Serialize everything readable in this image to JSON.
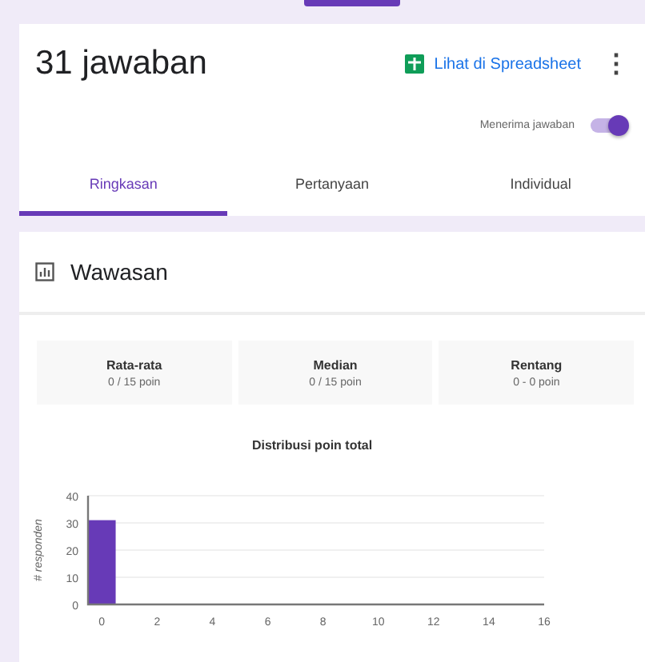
{
  "header": {
    "title": "31 jawaban",
    "spreadsheet_link": "Lihat di Spreadsheet",
    "more": "⋮",
    "accepting": {
      "label": "Menerima jawaban",
      "on": true
    }
  },
  "tabs": [
    {
      "label": "Ringkasan",
      "selected": true
    },
    {
      "label": "Pertanyaan",
      "selected": false
    },
    {
      "label": "Individual",
      "selected": false
    }
  ],
  "insights": {
    "title": "Wawasan",
    "stats": [
      {
        "label": "Rata-rata",
        "value": "0 / 15 poin"
      },
      {
        "label": "Median",
        "value": "0 / 15 poin"
      },
      {
        "label": "Rentang",
        "value": "0 - 0 poin"
      }
    ],
    "chart_data": {
      "type": "bar",
      "title": "Distribusi poin total",
      "ylabel": "# responden",
      "x": [
        0
      ],
      "values": [
        31
      ],
      "xlim": [
        -0.5,
        16
      ],
      "ylim": [
        0,
        40
      ],
      "xticks": [
        0,
        2,
        4,
        6,
        8,
        10,
        12,
        14,
        16
      ],
      "yticks": [
        0,
        10,
        20,
        30,
        40
      ],
      "grid": true
    }
  }
}
